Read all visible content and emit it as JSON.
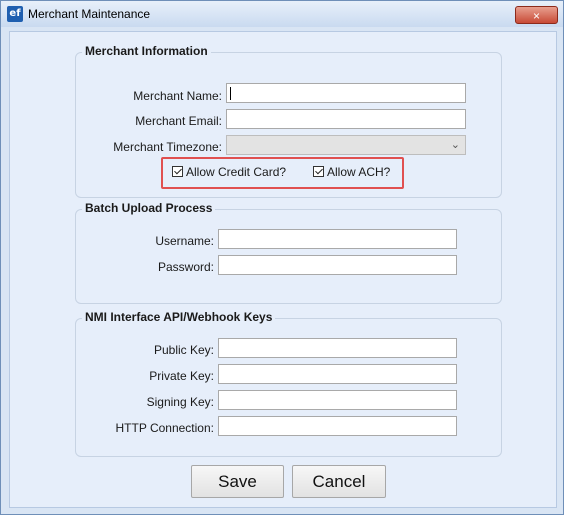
{
  "window": {
    "title": "Merchant Maintenance",
    "icon_text": "ef",
    "close_symbol": "×"
  },
  "merchant_info": {
    "title": "Merchant Information",
    "name_label": "Merchant Name:",
    "name_value": "",
    "email_label": "Merchant Email:",
    "email_value": "",
    "timezone_label": "Merchant Timezone:",
    "timezone_value": "",
    "allow_credit_card": {
      "label": "Allow Credit Card?",
      "checked": true
    },
    "allow_ach": {
      "label": "Allow ACH?",
      "checked": true
    }
  },
  "batch_upload": {
    "title": "Batch Upload Process",
    "username_label": "Username:",
    "username_value": "",
    "password_label": "Password:",
    "password_value": ""
  },
  "nmi_keys": {
    "title": "NMI Interface API/Webhook Keys",
    "public_key_label": "Public Key:",
    "public_key_value": "",
    "private_key_label": "Private Key:",
    "private_key_value": "",
    "signing_key_label": "Signing Key:",
    "signing_key_value": "",
    "http_connection_label": "HTTP Connection:",
    "http_connection_value": ""
  },
  "buttons": {
    "save": "Save",
    "cancel": "Cancel"
  },
  "colors": {
    "highlight": "#e05050",
    "close_button": "#c84a36",
    "app_icon": "#1f5fb0"
  }
}
